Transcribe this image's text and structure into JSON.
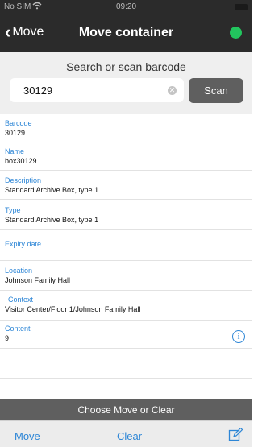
{
  "status_bar": {
    "carrier": "No SIM",
    "time": "09:20"
  },
  "nav": {
    "back_label": "Move",
    "title": "Move container",
    "status_color": "#22c55e"
  },
  "search": {
    "title": "Search or scan barcode",
    "value": "30129",
    "scan_label": "Scan"
  },
  "fields": {
    "barcode": {
      "label": "Barcode",
      "value": "30129"
    },
    "name": {
      "label": "Name",
      "value": "box30129"
    },
    "description": {
      "label": "Description",
      "value": "Standard Archive Box, type 1"
    },
    "type": {
      "label": "Type",
      "value": "Standard Archive Box, type 1"
    },
    "expiry": {
      "label": "Expiry date",
      "value": ""
    },
    "location": {
      "label": "Location",
      "value": "Johnson Family Hall"
    },
    "context": {
      "label": "Context",
      "value": "Visitor Center/Floor 1/Johnson Family Hall"
    },
    "content": {
      "label": "Content",
      "value": "9"
    }
  },
  "footer": {
    "prompt": "Choose Move or Clear",
    "move_label": "Move",
    "clear_label": "Clear"
  },
  "colors": {
    "accent": "#2d86d6",
    "nav_background": "#2b2b2b",
    "footer_bar": "#5f5f5f"
  },
  "icons": {
    "back": "chevron-left-icon",
    "clear": "clear-circle-icon",
    "info": "info-icon",
    "edit": "edit-icon"
  }
}
